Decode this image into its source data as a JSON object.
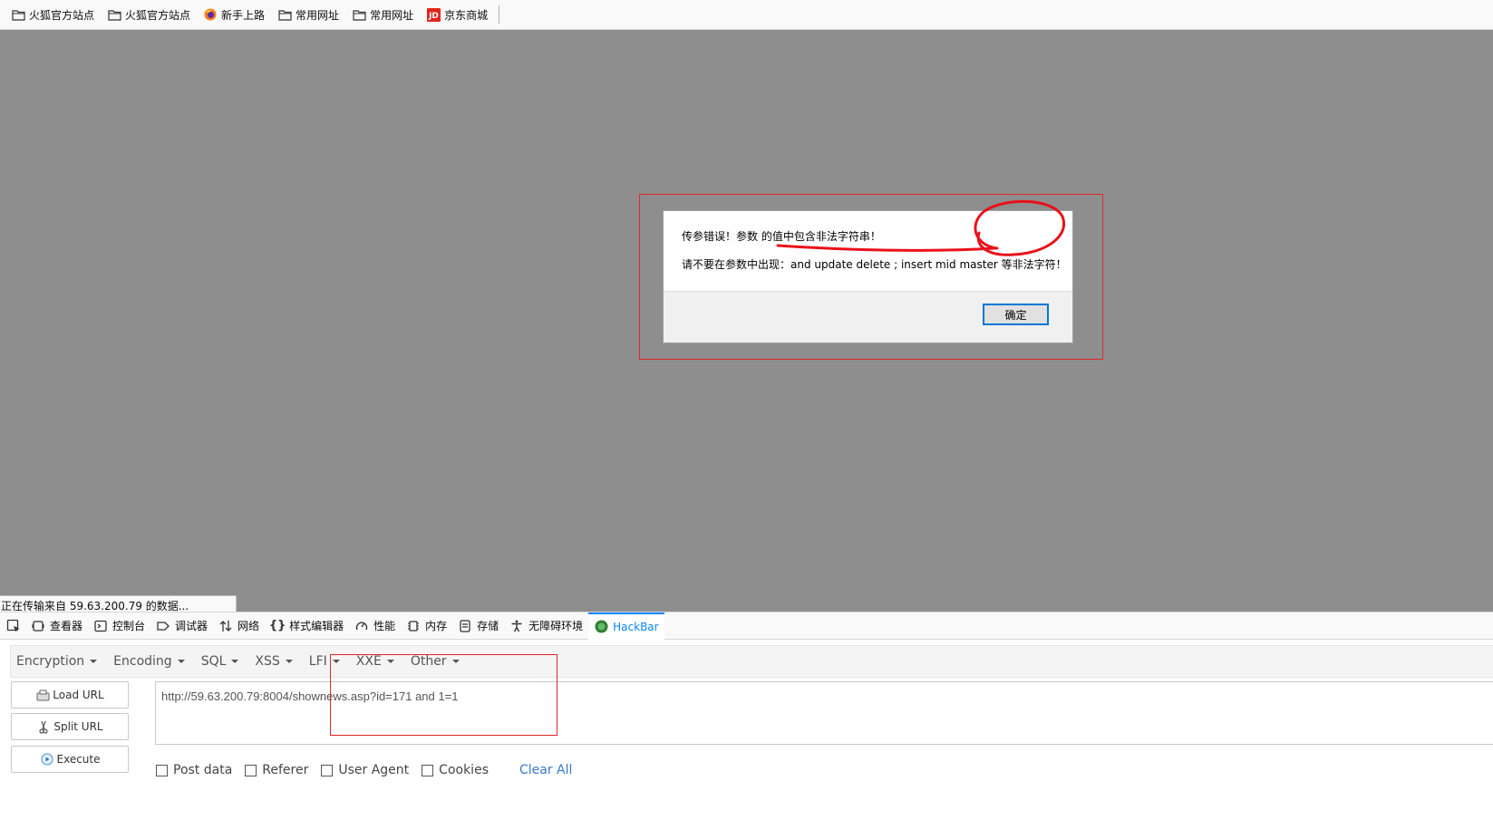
{
  "bookmarks": [
    {
      "label": "火狐官方站点",
      "icon": "folder-icon"
    },
    {
      "label": "火狐官方站点",
      "icon": "folder-icon"
    },
    {
      "label": "新手上路",
      "icon": "firefox-icon"
    },
    {
      "label": "常用网址",
      "icon": "folder-icon"
    },
    {
      "label": "常用网址",
      "icon": "folder-icon"
    },
    {
      "label": "京东商城",
      "icon": "jd-icon"
    }
  ],
  "dialog": {
    "line1": "传参错误！参数  的值中包含非法字符串！",
    "line2": "请不要在参数中出现：and update delete ; insert mid master 等非法字符！",
    "ok_label": "确定"
  },
  "status_text": "正在传输来自 59.63.200.79 的数据...",
  "devtools": {
    "tabs": [
      {
        "label": "查看器",
        "icon": "inspector-icon"
      },
      {
        "label": "控制台",
        "icon": "console-icon"
      },
      {
        "label": "调试器",
        "icon": "debugger-icon"
      },
      {
        "label": "网络",
        "icon": "network-icon"
      },
      {
        "label": "样式编辑器",
        "icon": "style-editor-icon"
      },
      {
        "label": "性能",
        "icon": "performance-icon"
      },
      {
        "label": "内存",
        "icon": "memory-icon"
      },
      {
        "label": "存储",
        "icon": "storage-icon"
      },
      {
        "label": "无障碍环境",
        "icon": "accessibility-icon"
      },
      {
        "label": "HackBar",
        "icon": "hackbar-icon",
        "active": true
      }
    ]
  },
  "hackbar": {
    "menus": [
      "Encryption",
      "Encoding",
      "SQL",
      "XSS",
      "LFI",
      "XXE",
      "Other"
    ],
    "load_url_label": "Load URL",
    "split_url_label": "Split URL",
    "execute_label": "Execute",
    "url_value": "http://59.63.200.79:8004/shownews.asp?id=171 and 1=1",
    "options": [
      "Post data",
      "Referer",
      "User Agent",
      "Cookies"
    ],
    "clear_all_label": "Clear All"
  },
  "colors": {
    "page_overlay": "#8e8e8e",
    "annotation_red": "#e0262b",
    "active_tab": "#0a84ff",
    "hackbar_link": "#3a7ac8"
  }
}
